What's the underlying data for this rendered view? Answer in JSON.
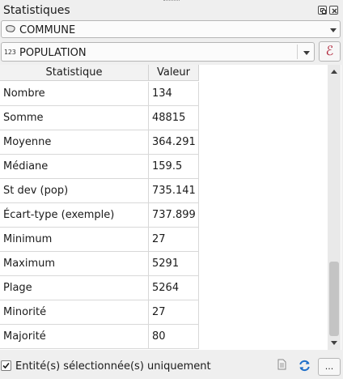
{
  "panel": {
    "title": "Statistiques"
  },
  "layer_select": {
    "value": "COMMUNE",
    "icon": "polygon-layer-icon"
  },
  "field_select": {
    "type_badge": "123",
    "value": "POPULATION",
    "expression_button": "ℰ"
  },
  "table": {
    "headers": {
      "statistic": "Statistique",
      "value": "Valeur"
    },
    "rows": [
      {
        "statistic": "Nombre",
        "value": "134"
      },
      {
        "statistic": "Somme",
        "value": "48815"
      },
      {
        "statistic": "Moyenne",
        "value": "364.291"
      },
      {
        "statistic": "Médiane",
        "value": "159.5"
      },
      {
        "statistic": "St dev (pop)",
        "value": "735.141"
      },
      {
        "statistic": "Écart-type (exemple)",
        "value": "737.899"
      },
      {
        "statistic": "Minimum",
        "value": "27"
      },
      {
        "statistic": "Maximum",
        "value": "5291"
      },
      {
        "statistic": "Plage",
        "value": "5264"
      },
      {
        "statistic": "Minorité",
        "value": "27"
      },
      {
        "statistic": "Majorité",
        "value": "80"
      }
    ]
  },
  "footer": {
    "selected_only_label": "Entité(s) sélectionnée(s) uniquement",
    "selected_only_checked": true,
    "more_button": "...",
    "accent_color": "#1f6fc9"
  }
}
